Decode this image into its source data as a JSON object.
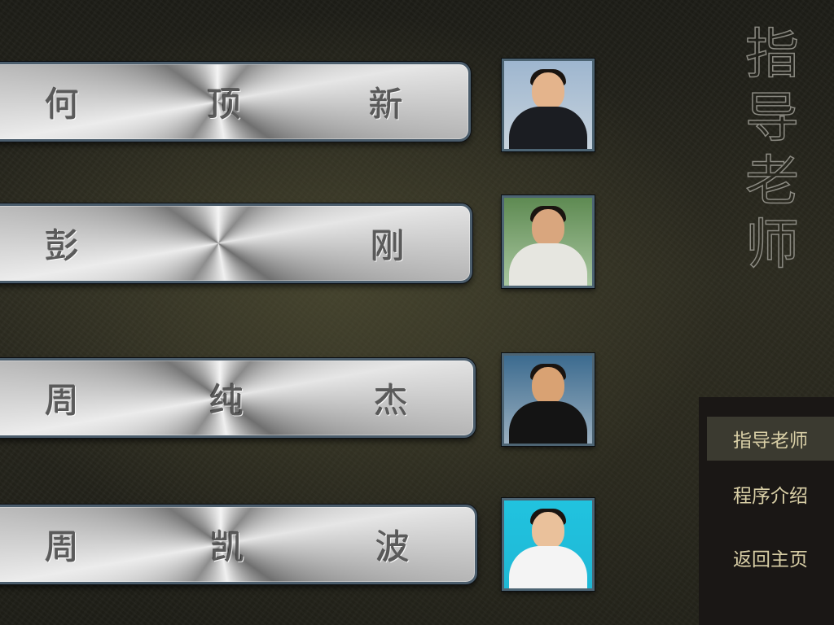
{
  "teachers": [
    {
      "chars": [
        "何",
        "顶",
        "新"
      ],
      "photo": {
        "bg": [
          "#9eb6cf",
          "#c7d3dd"
        ],
        "clothing": "#1b1d22",
        "skin": "#e4b48c"
      }
    },
    {
      "chars": [
        "彭",
        "刚"
      ],
      "photo": {
        "bg": [
          "#5e8a52",
          "#a9c7a0"
        ],
        "clothing": "#e6e6e0",
        "skin": "#d9a67e"
      }
    },
    {
      "chars": [
        "周",
        "纯",
        "杰"
      ],
      "photo": {
        "bg": [
          "#3c6b8f",
          "#9bb0c0"
        ],
        "clothing": "#141414",
        "skin": "#d9a273"
      }
    },
    {
      "chars": [
        "周",
        "凯",
        "波"
      ],
      "photo": {
        "bg": [
          "#21c3df",
          "#1fb8d6"
        ],
        "clothing": "#f4f4f4",
        "skin": "#eac19b"
      }
    }
  ],
  "side_title": [
    "指",
    "导",
    "老",
    "师"
  ],
  "menu": [
    {
      "label": "指导老师",
      "active": true
    },
    {
      "label": "程序介绍",
      "active": false
    },
    {
      "label": "返回主页",
      "active": false
    }
  ],
  "colors": {
    "menu_text": "#d9cfa6",
    "menu_active_bg": "#3b3a30",
    "bar_border": "#4b5d6c"
  }
}
